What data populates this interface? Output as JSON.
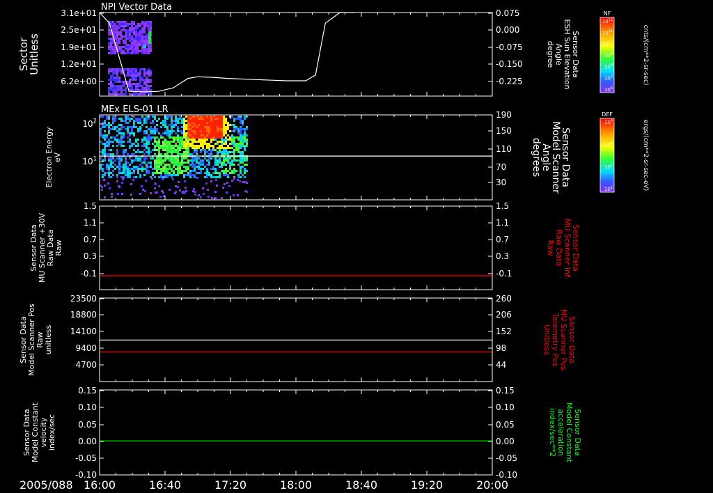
{
  "chart_data": {
    "type": "line",
    "date_label": "2005/088",
    "time_ticks": [
      "16:00",
      "16:40",
      "17:20",
      "18:00",
      "18:40",
      "19:20",
      "20:00"
    ],
    "panels": [
      {
        "title": "NPI Vector Data",
        "left_ylabel": [
          "Sector",
          "Unitless"
        ],
        "left_ticks": [
          "3.1e+01",
          "2.5e+01",
          "1.9e+01",
          "1.2e+01",
          "6.2e+00"
        ],
        "right_ylabel": [
          "Sensor Data",
          "ESH Sun Elevation",
          "Angle",
          "degree"
        ],
        "right_ticks": [
          "0.075",
          "0.000",
          "-0.075",
          "-0.150",
          "-0.225"
        ],
        "right_range": [
          -0.28,
          0.075
        ],
        "line": {
          "color": "#ffffff",
          "hours": [
            16.0,
            16.1,
            16.3,
            16.45,
            16.6,
            16.75,
            16.9,
            17.0,
            17.15,
            17.3,
            17.6,
            17.9,
            18.1,
            18.2,
            18.3,
            18.45,
            18.6
          ],
          "values": [
            0.075,
            0.03,
            -0.26,
            -0.262,
            -0.26,
            -0.245,
            -0.205,
            -0.198,
            -0.2,
            -0.205,
            -0.21,
            -0.215,
            -0.215,
            -0.19,
            0.03,
            0.075,
            0.075
          ]
        },
        "colorbar": {
          "label": "NF",
          "unit": "cnts/(cm**2-sr-sec)",
          "ticks": [
            "10^12",
            "10^11",
            "10^10",
            "10^9",
            "10^8",
            "10^7",
            "10^6"
          ]
        }
      },
      {
        "title": "MEx ELS-01 LR",
        "left_ylabel": [
          "Electron Energy",
          "eV"
        ],
        "left_ticks": [
          "10^2",
          "10^1"
        ],
        "right_ylabel": [
          "Sensor Data",
          "Model Scanner",
          "Angle",
          "degrees"
        ],
        "right_ticks": [
          "190",
          "150",
          "110",
          "70",
          "30"
        ],
        "right_range": [
          0,
          190
        ],
        "line": {
          "color": "#ffffff",
          "hours": [
            16.0,
            20.0
          ],
          "values": [
            98,
            98
          ]
        },
        "colorbar": {
          "label": "DEF",
          "unit": "ergs/(cm**2-sr-sec-eV)",
          "ticks": [
            "10^4",
            "10^3",
            "10^2",
            "10^1"
          ]
        }
      },
      {
        "title": "",
        "left_ylabel": [
          "Sensor Data",
          "MU Scanner +30V",
          "Raw Data",
          "Raw"
        ],
        "left_ticks": [
          "1.5",
          "1.1",
          "0.7",
          "0.3",
          "-0.1"
        ],
        "right_ylabel": [
          "Sensor Data",
          "MU Scanner Inf",
          "Raw Data",
          "Raw"
        ],
        "right_ticks": [
          "1.5",
          "1.1",
          "0.7",
          "0.3",
          "-0.1"
        ],
        "right_range": [
          -0.3,
          1.5
        ],
        "right_color": "#ff0000",
        "line": {
          "color": "#ff0000",
          "hours": [
            16.0,
            20.0
          ],
          "values": [
            0.0,
            0.0
          ]
        }
      },
      {
        "title": "",
        "left_ylabel": [
          "Sensor Data",
          "Model Scanner Pos",
          "Raw",
          "unitless"
        ],
        "left_ticks": [
          "23500",
          "18800",
          "14100",
          "9400",
          "4700"
        ],
        "right_ylabel": [
          "Sensor Data",
          "MU Scanner Pos",
          "Telemetry Pos",
          "Unitless"
        ],
        "right_ticks": [
          "260",
          "206",
          "152",
          "98",
          "44"
        ],
        "right_range": [
          0,
          260
        ],
        "right_color": "#ff0000",
        "lines": [
          {
            "color": "#ffffff",
            "hours": [
              16.0,
              20.0
            ],
            "values": [
              11700,
              11700
            ]
          },
          {
            "color": "#ff0000",
            "hours": [
              16.0,
              20.0
            ],
            "values": [
              8300,
              8300
            ]
          }
        ],
        "left_range": [
          0,
          23500
        ]
      },
      {
        "title": "",
        "left_ylabel": [
          "Sensor Data",
          "Model Constant",
          "velocity",
          "index/sec"
        ],
        "left_ticks": [
          "0.15",
          "0.10",
          "0.05",
          "0.00",
          "-0.05",
          "-0.10"
        ],
        "right_ylabel": [
          "Sensor Data",
          "Model Constant",
          "acceleration",
          "index/sec**2"
        ],
        "right_ticks": [
          "0.15",
          "0.10",
          "0.05",
          "0.00",
          "-0.05",
          "-0.10"
        ],
        "right_range": [
          -0.1,
          0.15
        ],
        "right_color": "#00ff00",
        "line": {
          "color": "#00ff00",
          "hours": [
            16.0,
            20.0
          ],
          "values": [
            0.0,
            0.0
          ]
        }
      }
    ]
  }
}
